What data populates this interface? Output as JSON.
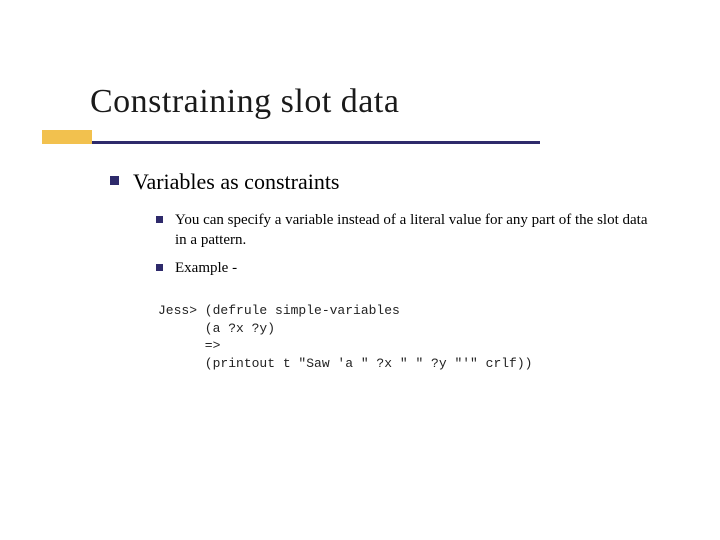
{
  "title": "Constraining slot data",
  "bullets": {
    "lvl1": "Variables as constraints",
    "lvl2": [
      "You can specify a variable instead of a literal value for any part of the slot data in a pattern.",
      "Example -"
    ]
  },
  "code": {
    "l1": "Jess> (defrule simple-variables",
    "l2": "      (a ?x ?y)",
    "l3": "      =>",
    "l4": "      (printout t \"Saw 'a \" ?x \" \" ?y \"'\" crlf))"
  }
}
